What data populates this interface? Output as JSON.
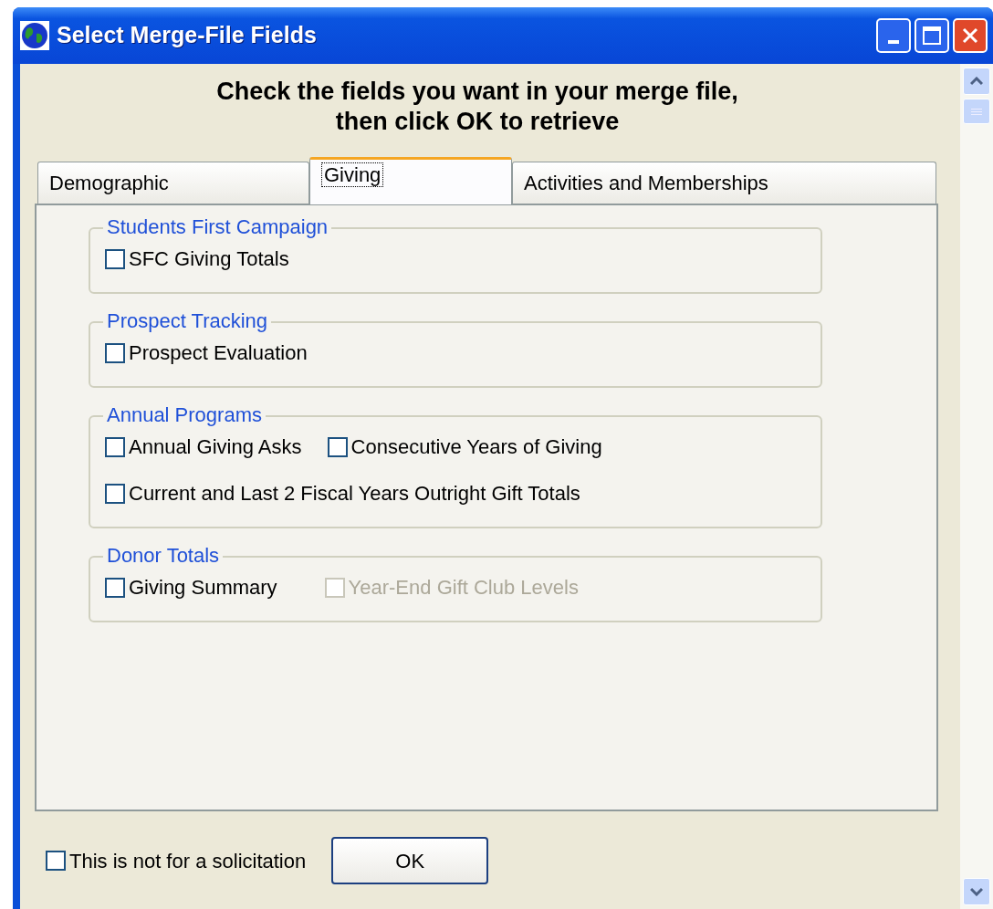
{
  "window": {
    "title": "Select Merge-File Fields"
  },
  "heading": [
    "Check the fields you want in your merge file,",
    "then click OK to retrieve"
  ],
  "tabs": [
    {
      "label": "Demographic",
      "selected": false
    },
    {
      "label": "Giving",
      "selected": true
    },
    {
      "label": "Activities and Memberships",
      "selected": false
    }
  ],
  "groups": [
    {
      "title": "Students First Campaign",
      "rows": [
        [
          {
            "label": "SFC Giving Totals",
            "checked": false,
            "disabled": false
          }
        ]
      ]
    },
    {
      "title": "Prospect Tracking",
      "rows": [
        [
          {
            "label": "Prospect Evaluation",
            "checked": false,
            "disabled": false
          }
        ]
      ]
    },
    {
      "title": "Annual Programs",
      "rows": [
        [
          {
            "label": "Annual Giving Asks",
            "checked": false,
            "disabled": false
          },
          {
            "label": "Consecutive Years of Giving",
            "checked": false,
            "disabled": false
          }
        ],
        [
          {
            "label": "Current and Last 2 Fiscal Years Outright Gift Totals",
            "checked": false,
            "disabled": false
          }
        ]
      ]
    },
    {
      "title": "Donor Totals",
      "rows": [
        [
          {
            "label": "Giving Summary",
            "checked": false,
            "disabled": false
          },
          {
            "label": "Year-End Gift Club Levels",
            "checked": false,
            "disabled": true
          }
        ]
      ]
    }
  ],
  "footer": {
    "checkbox": {
      "label": "This is not for a solicitation",
      "checked": false
    },
    "ok_button": "OK"
  }
}
